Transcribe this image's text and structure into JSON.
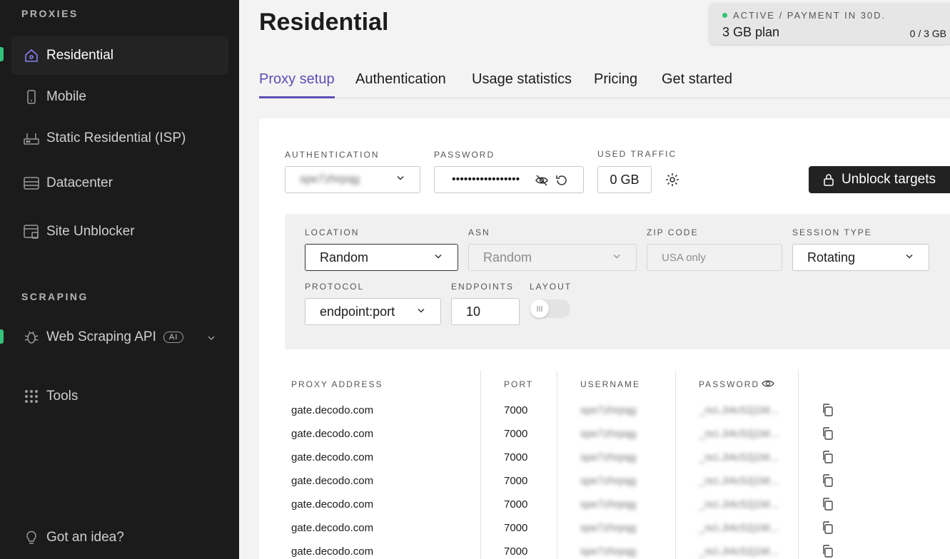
{
  "sidebar": {
    "sections": {
      "proxies": "PROXIES",
      "scraping": "SCRAPING"
    },
    "items": [
      {
        "label": "Residential",
        "icon": "home-icon"
      },
      {
        "label": "Mobile",
        "icon": "mobile-icon"
      },
      {
        "label": "Static Residential (ISP)",
        "icon": "router-icon"
      },
      {
        "label": "Datacenter",
        "icon": "server-icon"
      },
      {
        "label": "Site Unblocker",
        "icon": "browser-icon"
      },
      {
        "label": "Web Scraping API",
        "icon": "bug-icon",
        "badge": "AI"
      },
      {
        "label": "Tools",
        "icon": "grid-icon"
      },
      {
        "label": "Got an idea?",
        "icon": "lightbulb-icon"
      }
    ]
  },
  "header": {
    "title": "Residential",
    "plan": {
      "status": "ACTIVE / PAYMENT IN 30D.",
      "name": "3 GB plan",
      "usage": "0 / 3 GB"
    }
  },
  "tabs": [
    {
      "label": "Proxy setup",
      "active": true
    },
    {
      "label": "Authentication"
    },
    {
      "label": "Usage statistics"
    },
    {
      "label": "Pricing"
    },
    {
      "label": "Get started"
    }
  ],
  "auth": {
    "authentication_label": "AUTHENTICATION",
    "authentication_value": "spe7zhrpqg",
    "password_label": "PASSWORD",
    "password_value": "•••••••••••••••••",
    "used_traffic_label": "USED TRAFFIC",
    "used_traffic_value": "0 GB",
    "unblock_label": "Unblock targets"
  },
  "config": {
    "location_label": "LOCATION",
    "location_value": "Random",
    "asn_label": "ASN",
    "asn_value": "Random",
    "zip_label": "ZIP CODE",
    "zip_placeholder": "USA only",
    "session_label": "SESSION TYPE",
    "session_value": "Rotating",
    "protocol_label": "PROTOCOL",
    "protocol_value": "endpoint:port",
    "endpoints_label": "ENDPOINTS",
    "endpoints_value": "10",
    "layout_label": "LAYOUT"
  },
  "table": {
    "headers": {
      "address": "PROXY ADDRESS",
      "port": "PORT",
      "username": "USERNAME",
      "password": "PASSWORD"
    },
    "rows": [
      {
        "address": "gate.decodo.com",
        "port": "7000",
        "username": "spe7zhrpqg",
        "password": "_nci.Ji4c52j1M..."
      },
      {
        "address": "gate.decodo.com",
        "port": "7000",
        "username": "spe7zhrpqg",
        "password": "_nci.Ji4c52j1M..."
      },
      {
        "address": "gate.decodo.com",
        "port": "7000",
        "username": "spe7zhrpqg",
        "password": "_nci.Ji4c52j1M..."
      },
      {
        "address": "gate.decodo.com",
        "port": "7000",
        "username": "spe7zhrpqg",
        "password": "_nci.Ji4c52j1M..."
      },
      {
        "address": "gate.decodo.com",
        "port": "7000",
        "username": "spe7zhrpqg",
        "password": "_nci.Ji4c52j1M..."
      },
      {
        "address": "gate.decodo.com",
        "port": "7000",
        "username": "spe7zhrpqg",
        "password": "_nci.Ji4c52j1M..."
      },
      {
        "address": "gate.decodo.com",
        "port": "7000",
        "username": "spe7zhrpqg",
        "password": "_nci.Ji4c52j1M..."
      }
    ]
  },
  "colors": {
    "accent": "#5a4fb3",
    "status_green": "#34c27a",
    "sidebar_bg": "#1b1b1b"
  }
}
